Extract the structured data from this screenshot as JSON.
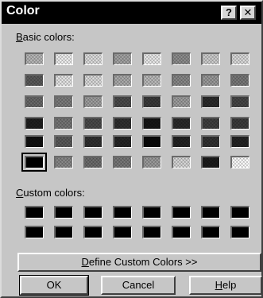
{
  "window": {
    "title": "Color",
    "help_btn": "?",
    "close_btn": "✕"
  },
  "labels": {
    "basic_prefix": "B",
    "basic_rest": "asic colors:",
    "custom_prefix": "C",
    "custom_rest": "ustom colors:"
  },
  "basic_colors": [
    [
      "#b9b9b9",
      "#f2f2f2",
      "#e0e0e0",
      "#a5a5a5",
      "#ececec",
      "#8f8f8f",
      "#cfcfcf",
      "#dddddd"
    ],
    [
      "#5b5b5b",
      "#e8e8e8",
      "#dedede",
      "#adadad",
      "#bcbcbc",
      "#8a8a8a",
      "#9c9c9c",
      "#7a7a7a"
    ],
    [
      "#6a6a6a",
      "#7e7e7e",
      "#a0a0a0",
      "#4b4b4b",
      "#3a3a3a",
      "#a0a0a0",
      "#2b2b2b",
      "#474747"
    ],
    [
      "#202020",
      "#777777",
      "#4a4a4a",
      "#303030",
      "#161616",
      "#2b2b2b",
      "#404040",
      "#3c3c3c"
    ],
    [
      "#111111",
      "#5b5b5b",
      "#2f2f2f",
      "#262626",
      "#090909",
      "#232323",
      "#333333",
      "#242424"
    ],
    [
      "#000000",
      "#8a8a8a",
      "#6e6e6e",
      "#7a7a7a",
      "#9d9d9d",
      "#d9d9d9",
      "#1c1c1c",
      "#ffffff"
    ]
  ],
  "custom_colors": [
    [
      "#000000",
      "#000000",
      "#000000",
      "#000000",
      "#000000",
      "#000000",
      "#000000",
      "#000000"
    ],
    [
      "#000000",
      "#000000",
      "#000000",
      "#000000",
      "#000000",
      "#000000",
      "#000000",
      "#000000"
    ]
  ],
  "buttons": {
    "define_prefix": "D",
    "define_rest": "efine Custom Colors >>",
    "ok": "OK",
    "cancel": "Cancel",
    "help_prefix": "H",
    "help_rest": "elp"
  }
}
